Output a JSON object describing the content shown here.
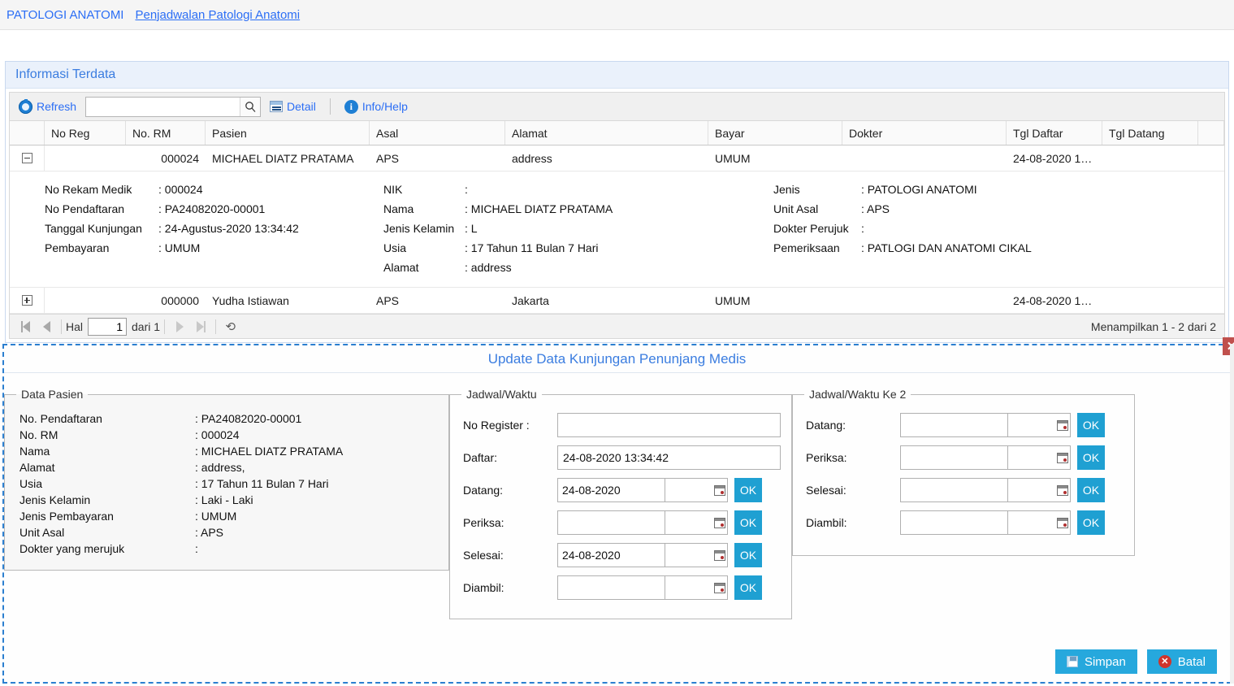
{
  "breadcrumb": {
    "root": "PATOLOGI ANATOMI",
    "current": "Penjadwalan Patologi Anatomi"
  },
  "panel": {
    "title": "Informasi Terdata"
  },
  "toolbar": {
    "refresh_label": "Refresh",
    "search_value": "",
    "search_placeholder": "",
    "search_icon": "magnifier-icon",
    "detail_label": "Detail",
    "info_label": "Info/Help",
    "refresh_icon": "refresh-icon",
    "detail_icon": "detail-icon",
    "info_icon": "info-icon"
  },
  "grid": {
    "columns": [
      "No Reg",
      "No. RM",
      "Pasien",
      "Asal",
      "Alamat",
      "Bayar",
      "Dokter",
      "Tgl Daftar",
      "Tgl Datang"
    ],
    "rows": [
      {
        "expanded": true,
        "no_reg": "",
        "no_rm": "000024",
        "pasien": "MICHAEL DIATZ PRATAMA",
        "asal": "APS",
        "alamat": "address",
        "bayar": "UMUM",
        "dokter": "",
        "tgl_daftar": "24-08-2020 1…",
        "tgl_datang": ""
      },
      {
        "expanded": false,
        "no_reg": "",
        "no_rm": "000000",
        "pasien": "Yudha Istiawan",
        "asal": "APS",
        "alamat": "Jakarta",
        "bayar": "UMUM",
        "dokter": "",
        "tgl_daftar": "24-08-2020 1…",
        "tgl_datang": ""
      }
    ],
    "row_detail": {
      "col1": [
        {
          "key": "No Rekam Medik",
          "value": ": 000024"
        },
        {
          "key": "No Pendaftaran",
          "value": ": PA24082020-00001"
        },
        {
          "key": "Tanggal Kunjungan",
          "value": ": 24-Agustus-2020 13:34:42"
        },
        {
          "key": "Pembayaran",
          "value": ": UMUM"
        }
      ],
      "col2": [
        {
          "key": "NIK",
          "value": ":"
        },
        {
          "key": "Nama",
          "value": ": MICHAEL DIATZ PRATAMA"
        },
        {
          "key": "Jenis Kelamin",
          "value": ": L"
        },
        {
          "key": "Usia",
          "value": ": 17 Tahun 11 Bulan 7 Hari"
        },
        {
          "key": "Alamat",
          "value": ": address"
        }
      ],
      "col3": [
        {
          "key": "Jenis",
          "value": ": PATOLOGI ANATOMI"
        },
        {
          "key": "Unit Asal",
          "value": ": APS"
        },
        {
          "key": "Dokter Perujuk",
          "value": ":"
        },
        {
          "key": "Pemeriksaan",
          "value": ": PATLOGI DAN ANATOMI CIKAL"
        }
      ]
    }
  },
  "pager": {
    "hal_label": "Hal",
    "page_value": "1",
    "of_label": "dari 1",
    "status": "Menampilkan 1 - 2 dari 2",
    "first_icon": "first-page-icon",
    "prev_icon": "previous-page-icon",
    "next_icon": "next-page-icon",
    "last_icon": "last-page-icon",
    "refresh_icon": "refresh-icon"
  },
  "modal": {
    "title": "Update Data Kunjungan Penunjang Medis",
    "close_label": "✕",
    "data_pasien": {
      "legend": "Data Pasien",
      "fields": [
        {
          "key": "No. Pendaftaran",
          "value": ": PA24082020-00001"
        },
        {
          "key": "No. RM",
          "value": ": 000024"
        },
        {
          "key": "Nama",
          "value": ": MICHAEL DIATZ PRATAMA"
        },
        {
          "key": "Alamat",
          "value": ": address,"
        },
        {
          "key": "Usia",
          "value": ": 17 Tahun 11 Bulan 7 Hari"
        },
        {
          "key": "Jenis Kelamin",
          "value": ": Laki - Laki"
        },
        {
          "key": "Jenis Pembayaran",
          "value": ": UMUM"
        },
        {
          "key": "Unit Asal",
          "value": ": APS"
        },
        {
          "key": "Dokter yang merujuk",
          "value": ":"
        }
      ]
    },
    "jadwal": {
      "legend": "Jadwal/Waktu",
      "no_register_label": "No Register :",
      "no_register_value": "",
      "daftar_label": "Daftar:",
      "daftar_value": "24-08-2020 13:34:42",
      "ok_label": "OK",
      "rows": [
        {
          "label": "Datang:",
          "date": "24-08-2020",
          "time": ""
        },
        {
          "label": "Periksa:",
          "date": "",
          "time": ""
        },
        {
          "label": "Selesai:",
          "date": "24-08-2020",
          "time": ""
        },
        {
          "label": "Diambil:",
          "date": "",
          "time": ""
        }
      ]
    },
    "jadwal2": {
      "legend": "Jadwal/Waktu Ke 2",
      "ok_label": "OK",
      "rows": [
        {
          "label": "Datang:",
          "date": "",
          "time": ""
        },
        {
          "label": "Periksa:",
          "date": "",
          "time": ""
        },
        {
          "label": "Selesai:",
          "date": "",
          "time": ""
        },
        {
          "label": "Diambil:",
          "date": "",
          "time": ""
        }
      ]
    },
    "footer": {
      "save_label": "Simpan",
      "cancel_label": "Batal",
      "save_icon": "save-icon",
      "cancel_icon": "cancel-icon"
    }
  },
  "colors": {
    "link": "#2b6ef5",
    "panel_title": "#3b7de0",
    "accent_button": "#26a8dd",
    "ok_button": "#1fa0d2",
    "close_red": "#c0504d",
    "cancel_red": "#d0342c",
    "modal_border": "#2b7fd0"
  }
}
